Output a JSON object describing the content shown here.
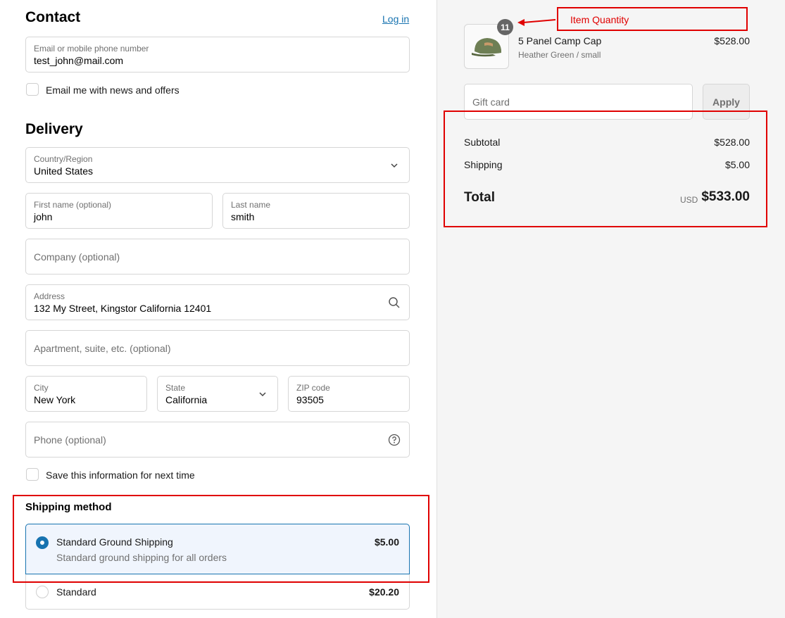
{
  "contact": {
    "heading": "Contact",
    "login_link": "Log in",
    "email_label": "Email or mobile phone number",
    "email_value": "test_john@mail.com",
    "news_checkbox_label": "Email me with news and offers"
  },
  "delivery": {
    "heading": "Delivery",
    "country_label": "Country/Region",
    "country_value": "United States",
    "first_name_label": "First name (optional)",
    "first_name_value": "john",
    "last_name_label": "Last name",
    "last_name_value": "smith",
    "company_placeholder": "Company (optional)",
    "address_label": "Address",
    "address_value": "132 My Street, Kingstor California   12401",
    "apartment_placeholder": "Apartment, suite, etc. (optional)",
    "city_label": "City",
    "city_value": "New York",
    "state_label": "State",
    "state_value": "California",
    "zip_label": "ZIP code",
    "zip_value": "93505",
    "phone_placeholder": "Phone (optional)",
    "save_checkbox_label": "Save this information for next time"
  },
  "shipping": {
    "heading": "Shipping method",
    "options": [
      {
        "name": "Standard Ground Shipping",
        "description": "Standard ground shipping for all orders",
        "price": "$5.00",
        "selected": true
      },
      {
        "name": "Standard",
        "description": "",
        "price": "$20.20",
        "selected": false
      }
    ]
  },
  "cart": {
    "item": {
      "quantity": "11",
      "name": "5 Panel Camp Cap",
      "variant": "Heather Green / small",
      "price": "$528.00"
    },
    "gift_card_placeholder": "Gift card",
    "apply_label": "Apply",
    "subtotal_label": "Subtotal",
    "subtotal_value": "$528.00",
    "shipping_label": "Shipping",
    "shipping_value": "$5.00",
    "total_label": "Total",
    "total_currency": "USD",
    "total_value": "$533.00"
  },
  "annotations": {
    "item_quantity_label": "Item Quantity"
  },
  "colors": {
    "accent": "#1773b0",
    "annotation": "#e00000",
    "summary_bg": "#f5f5f5"
  }
}
